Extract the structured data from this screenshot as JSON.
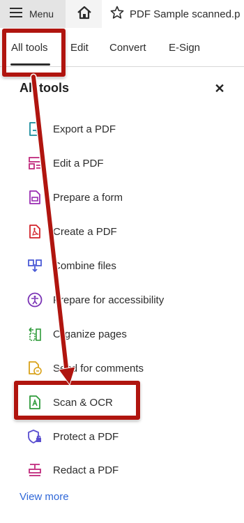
{
  "topbar": {
    "menu_label": "Menu",
    "doc_title": "PDF Sample scanned.p"
  },
  "tabs": [
    {
      "label": "All tools",
      "active": true
    },
    {
      "label": "Edit"
    },
    {
      "label": "Convert"
    },
    {
      "label": "E-Sign"
    }
  ],
  "panel": {
    "title": "All tools",
    "close": "✕",
    "view_more": "View more"
  },
  "tools": [
    {
      "label": "Export a PDF",
      "icon": "export-pdf-icon",
      "color": "#1a8c9c"
    },
    {
      "label": "Edit a PDF",
      "icon": "edit-pdf-icon",
      "color": "#c0287c"
    },
    {
      "label": "Prepare a form",
      "icon": "prepare-form-icon",
      "color": "#9a2db3"
    },
    {
      "label": "Create a PDF",
      "icon": "create-pdf-icon",
      "color": "#d3232a"
    },
    {
      "label": "Combine files",
      "icon": "combine-files-icon",
      "color": "#4b5bd6"
    },
    {
      "label": "Prepare for accessibility",
      "icon": "accessibility-icon",
      "color": "#7a33b5"
    },
    {
      "label": "Organize pages",
      "icon": "organize-pages-icon",
      "color": "#2e9b3a"
    },
    {
      "label": "Send for comments",
      "icon": "send-comments-icon",
      "color": "#d9a21a"
    },
    {
      "label": "Scan & OCR",
      "icon": "scan-ocr-icon",
      "color": "#2e9b3a"
    },
    {
      "label": "Protect a PDF",
      "icon": "protect-pdf-icon",
      "color": "#5a4fd0"
    },
    {
      "label": "Redact a PDF",
      "icon": "redact-pdf-icon",
      "color": "#c0287c"
    }
  ],
  "annotation_color": "#b0150f"
}
